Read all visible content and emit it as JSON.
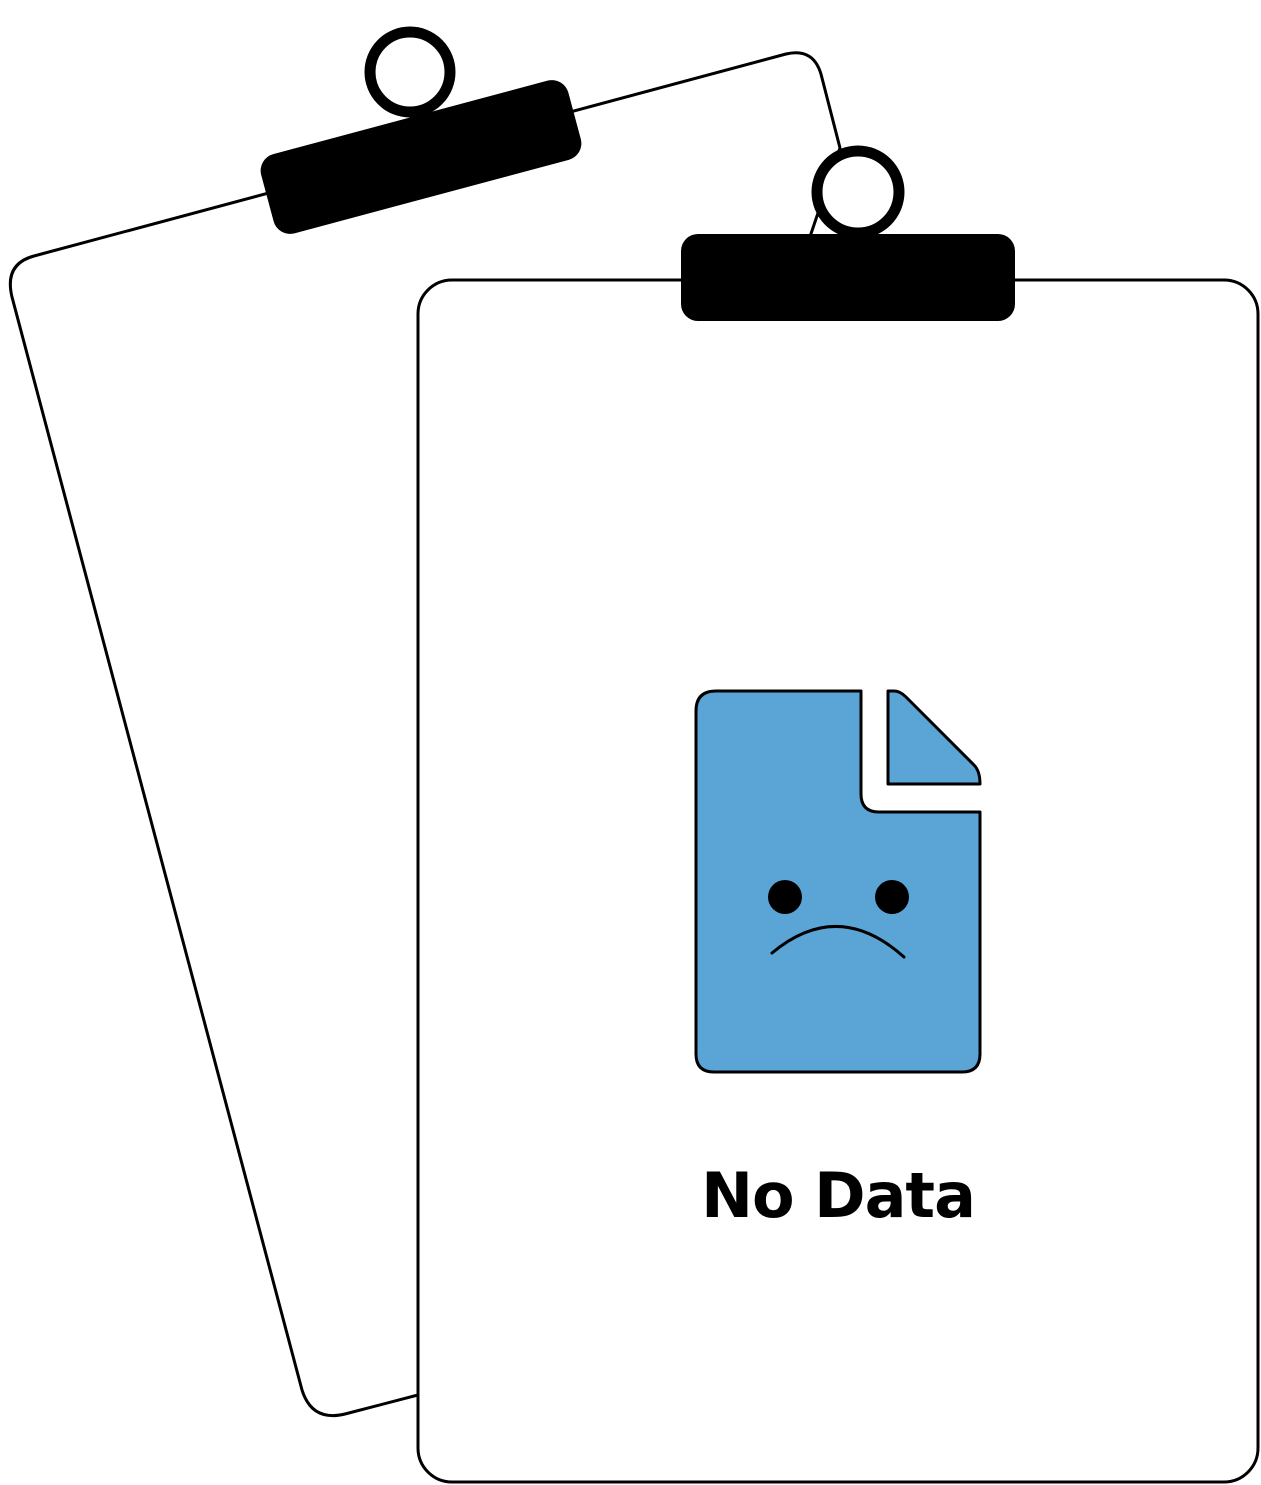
{
  "empty_state": {
    "message": "No Data",
    "icon": "sad-document-icon",
    "illustration": "clipboard-pair"
  },
  "colors": {
    "document_fill": "#5aa4d6",
    "outline": "#000000",
    "background": "#ffffff"
  }
}
